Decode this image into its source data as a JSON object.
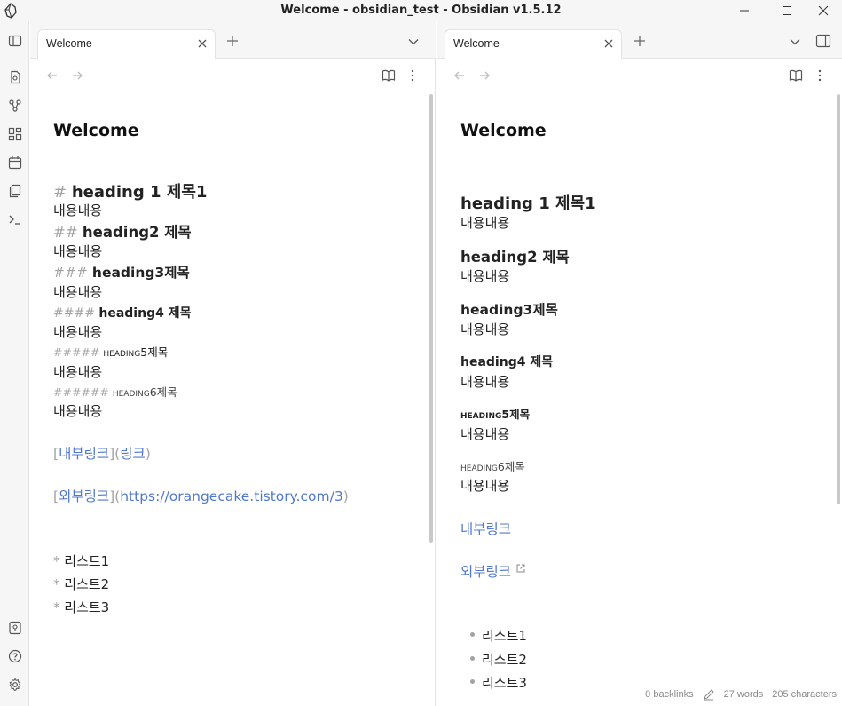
{
  "window": {
    "title": "Welcome - obsidian_test - Obsidian v1.5.12"
  },
  "tabs": {
    "left": {
      "label": "Welcome"
    },
    "right": {
      "label": "Welcome"
    }
  },
  "ribbon": {
    "icons": [
      "files-icon",
      "graph-icon",
      "canvas-icon",
      "calendar-icon",
      "templates-icon",
      "terminal-icon",
      "vault-icon",
      "help-icon",
      "settings-icon"
    ]
  },
  "editor": {
    "title": "Welcome",
    "h1_mark": "#",
    "h1_text": "heading 1 제목1",
    "body1": "내용내용",
    "h2_mark": "##",
    "h2_text": "heading2 제목",
    "body2": "내용내용",
    "h3_mark": "###",
    "h3_text": "heading3제목",
    "body3": "내용내용",
    "h4_mark": "####",
    "h4_text": "heading4 제목",
    "body4": "내용내용",
    "h5_mark": "#####",
    "h5_text": "heading5제목",
    "body5": "내용내용",
    "h6_mark": "######",
    "h6_text": "heading6제목",
    "body6": "내용내용",
    "link1_open": "[",
    "link1_text": "내부링크",
    "link1_mid": "](",
    "link1_target": "링크",
    "link1_close": ")",
    "link2_open": "[",
    "link2_text": "외부링크",
    "link2_mid": "](",
    "link2_target": "https://orangecake.tistory.com/3",
    "link2_close": ")",
    "list_mark": "*",
    "list": [
      "리스트1",
      "리스트2",
      "리스트3"
    ]
  },
  "preview": {
    "title": "Welcome",
    "h1": "heading 1 제목1",
    "body1": "내용내용",
    "h2": "heading2 제목",
    "body2": "내용내용",
    "h3": "heading3제목",
    "body3": "내용내용",
    "h4": "heading4 제목",
    "body4": "내용내용",
    "h5": "heading5제목",
    "body5": "내용내용",
    "h6": "heading6제목",
    "body6": "내용내용",
    "link_internal": "내부링크",
    "link_external": "외부링크",
    "list": [
      "리스트1",
      "리스트2",
      "리스트3"
    ]
  },
  "status": {
    "backlinks": "0 backlinks",
    "words": "27 words",
    "characters": "205 characters"
  },
  "colors": {
    "link": "#5078d2",
    "muted": "#a3a3a3",
    "chrome": "#f6f6f6"
  }
}
